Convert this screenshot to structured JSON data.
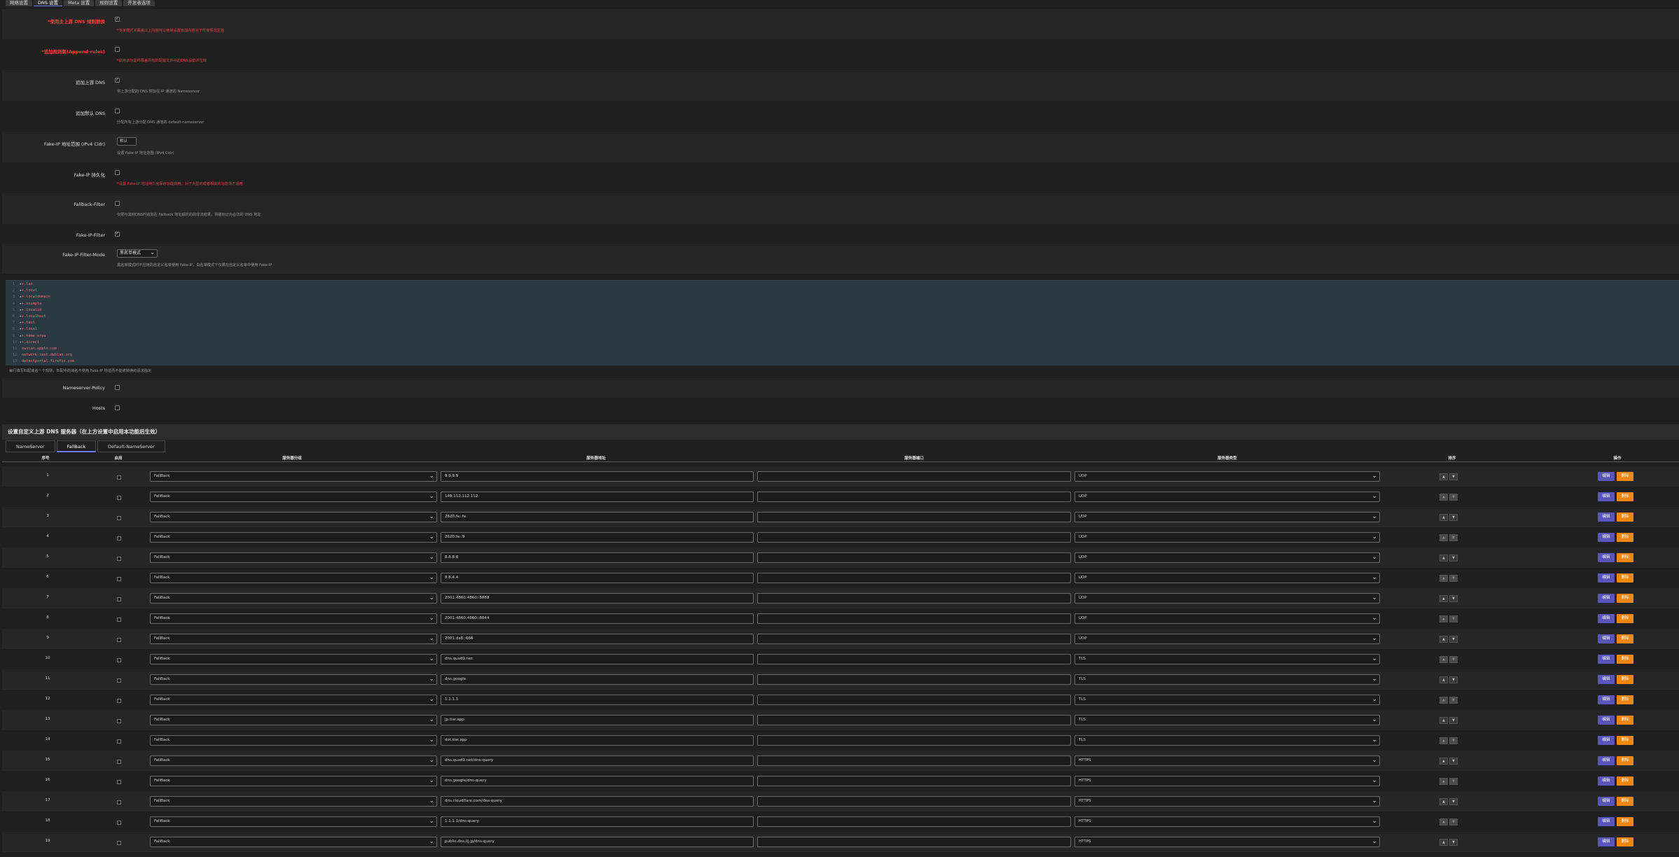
{
  "tabs": [
    "网络设置",
    "DNS 设置",
    "Meta 设置",
    "规则设置",
    "开发者选项"
  ],
  "active_tab": 1,
  "settings": [
    {
      "label": "*使用主上游 DNS 规则替换",
      "label_red": true,
      "checked": true,
      "desc": "*专家模式并覆盖以上内容可以继续设置追加内容对于所有情况生效",
      "desc_red": true,
      "control": "checkbox"
    },
    {
      "label": "*追加规则集(Append-rules)",
      "label_red": true,
      "checked": false,
      "desc": "*启用该功能将覆盖原有的配置文件中的DNS设置并生效",
      "desc_red": true,
      "control": "checkbox"
    },
    {
      "label": "追加上游 DNS",
      "label_red": false,
      "checked": true,
      "desc": "将上游分配的 DNS 附加在 IP 通道的 Nameserver",
      "desc_red": false,
      "control": "checkbox"
    },
    {
      "label": "追加默认 DNS",
      "label_red": false,
      "checked": false,
      "desc": "分配所有上游分配 DNS 通道的 default-nameserver",
      "desc_red": false,
      "control": "checkbox"
    },
    {
      "label": "Fake-IP 地址范围 (IPv4 Cidr)",
      "label_red": false,
      "checked": false,
      "desc": "设置 Fake-IP 地址范围 (IPv4 Cidr)",
      "desc_red": false,
      "control": "select",
      "value": "默认"
    },
    {
      "label": "Fake-IP 持久化",
      "label_red": false,
      "checked": false,
      "desc": "*设置 Fake-IP 地址持久化保存功能启用，对于大型的或者相关的功能并不适用",
      "desc_red": true,
      "control": "checkbox"
    },
    {
      "label": "Fallback-Filter",
      "label_red": false,
      "checked": false,
      "desc": "仅限与其他DNS时追加在 Fallback 地址解析的的非法结果，将被标记为合法的 DNS 地址",
      "desc_red": false,
      "control": "checkbox"
    },
    {
      "label": "Fake-IP-Filter",
      "label_red": false,
      "checked": true,
      "desc": "",
      "desc_red": false,
      "control": "checkbox"
    },
    {
      "label": "Fake-IP-Filter-Mode",
      "label_red": false,
      "checked": false,
      "desc": "黑名单模式时不应用的自定义名单使用 Fake-IP，白名单模式下仅限在自定义名单中使用 Fake-IP",
      "desc_red": false,
      "control": "mode",
      "value": "黑名单模式"
    }
  ],
  "editor_lines": [
    {
      "n": "1",
      "fold": true,
      "text": "+.lan"
    },
    {
      "n": "2",
      "fold": true,
      "text": "+.local"
    },
    {
      "n": "3",
      "fold": true,
      "text": "+.localdomain"
    },
    {
      "n": "4",
      "fold": true,
      "text": "+.example"
    },
    {
      "n": "5",
      "fold": true,
      "text": "+.invalid"
    },
    {
      "n": "6",
      "fold": true,
      "text": "+.localhost"
    },
    {
      "n": "7",
      "fold": true,
      "text": "+.test"
    },
    {
      "n": "8",
      "fold": true,
      "text": "+.local"
    },
    {
      "n": "9",
      "fold": true,
      "text": "+.home.arpa"
    },
    {
      "n": "10",
      "fold": true,
      "text": "+.direct"
    },
    {
      "n": "11",
      "fold": false,
      "text": "swscan.apple.com"
    },
    {
      "n": "12",
      "fold": false,
      "text": "network-test.debian.org"
    },
    {
      "n": "13",
      "fold": false,
      "text": "detectportal.firefox.com"
    }
  ],
  "editor_help": "每行填写匹配域名一个规则，匹配中的域名不使用 Fake-IP 地址而不能被转换的请求指定",
  "policy_rows": [
    {
      "label": "Nameserver-Policy",
      "checked": false
    },
    {
      "label": "Hosts",
      "checked": false
    }
  ],
  "section_title": "设置自定义上游 DNS 服务器（在上方设置中启用本功能后生效）",
  "subtabs": [
    "NameServer",
    "FallBack",
    "Default-NameServer"
  ],
  "active_subtab": 1,
  "table_headers": {
    "num": "序号",
    "enable": "启用",
    "group": "服务器分组",
    "address": "服务器地址",
    "port": "服务器端口",
    "type": "服务器类型",
    "sort": "排序",
    "action": "操作"
  },
  "row_group": "FallBack",
  "edit_label": "编辑",
  "delete_label": "删除",
  "up_arrow": "▲",
  "down_arrow": "▼",
  "rows": [
    {
      "num": "1",
      "address": "9.9.9.9",
      "type": "UDP"
    },
    {
      "num": "2",
      "address": "149.112.112.112",
      "type": "UDP"
    },
    {
      "num": "3",
      "address": "2620:fe::fe",
      "type": "UDP"
    },
    {
      "num": "4",
      "address": "2620:fe::9",
      "type": "UDP"
    },
    {
      "num": "5",
      "address": "8.8.8.8",
      "type": "UDP"
    },
    {
      "num": "6",
      "address": "8.8.4.4",
      "type": "UDP"
    },
    {
      "num": "7",
      "address": "2001:4860:4860::8888",
      "type": "UDP"
    },
    {
      "num": "8",
      "address": "2001:4860:4860::8844",
      "type": "UDP"
    },
    {
      "num": "9",
      "address": "2001:da8::666",
      "type": "UDP"
    },
    {
      "num": "10",
      "address": "dns.quad9.net",
      "type": "TLS"
    },
    {
      "num": "11",
      "address": "dns.google",
      "type": "TLS"
    },
    {
      "num": "12",
      "address": "1.1.1.1",
      "type": "TLS"
    },
    {
      "num": "13",
      "address": "jp.tiar.app",
      "type": "TLS"
    },
    {
      "num": "14",
      "address": "dot.tiar.app",
      "type": "TLS"
    },
    {
      "num": "15",
      "address": "dns.quad9.net/dns-query",
      "type": "HTTPS"
    },
    {
      "num": "16",
      "address": "dns.google/dns-query",
      "type": "HTTPS"
    },
    {
      "num": "17",
      "address": "dns.cloudflare.com/dns-query",
      "type": "HTTPS"
    },
    {
      "num": "18",
      "address": "1.1.1.1/dns-query",
      "type": "HTTPS"
    },
    {
      "num": "19",
      "address": "public.dns.iij.jp/dns-query",
      "type": "HTTPS"
    }
  ],
  "colors": {
    "accent": "#6f7cff",
    "edit": "#5a55b8",
    "delete": "#f0850f",
    "warning": "#ff3b3b",
    "editor_bg": "#2b3a42"
  }
}
